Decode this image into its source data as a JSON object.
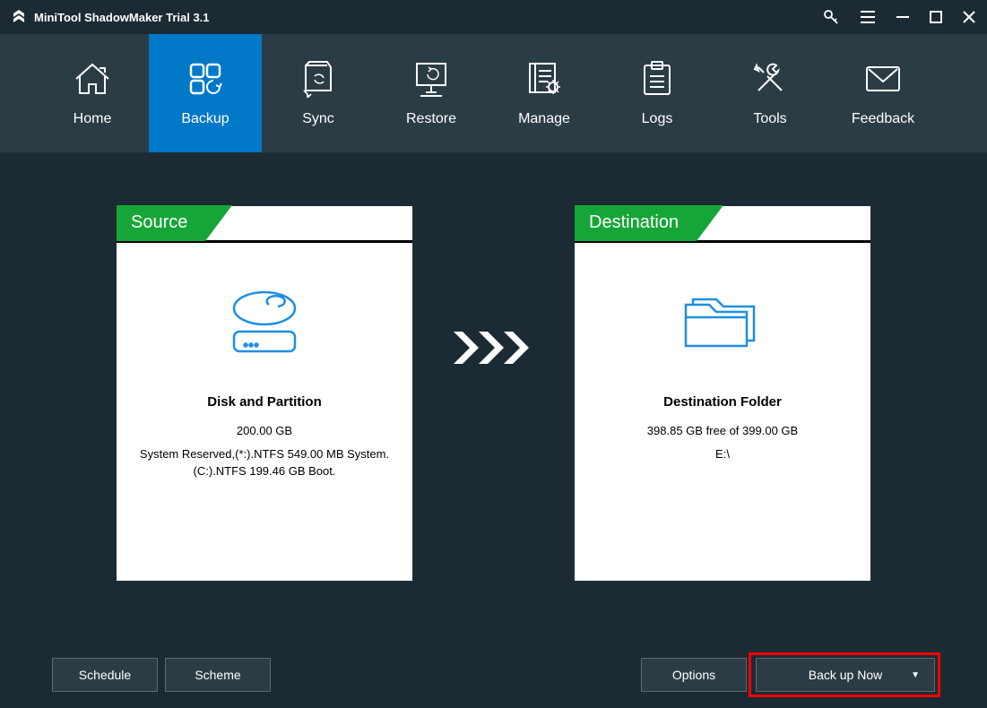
{
  "titlebar": {
    "title": "MiniTool ShadowMaker Trial 3.1"
  },
  "nav": {
    "items": [
      {
        "label": "Home"
      },
      {
        "label": "Backup"
      },
      {
        "label": "Sync"
      },
      {
        "label": "Restore"
      },
      {
        "label": "Manage"
      },
      {
        "label": "Logs"
      },
      {
        "label": "Tools"
      },
      {
        "label": "Feedback"
      }
    ]
  },
  "source": {
    "header": "Source",
    "heading": "Disk and Partition",
    "size": "200.00 GB",
    "detail": "System Reserved,(*:).NTFS 549.00 MB System.(C:).NTFS 199.46 GB Boot."
  },
  "destination": {
    "header": "Destination",
    "heading": "Destination Folder",
    "size": "398.85 GB free of 399.00 GB",
    "detail": "E:\\"
  },
  "footer": {
    "schedule": "Schedule",
    "scheme": "Scheme",
    "options": "Options",
    "backup": "Back up Now"
  }
}
